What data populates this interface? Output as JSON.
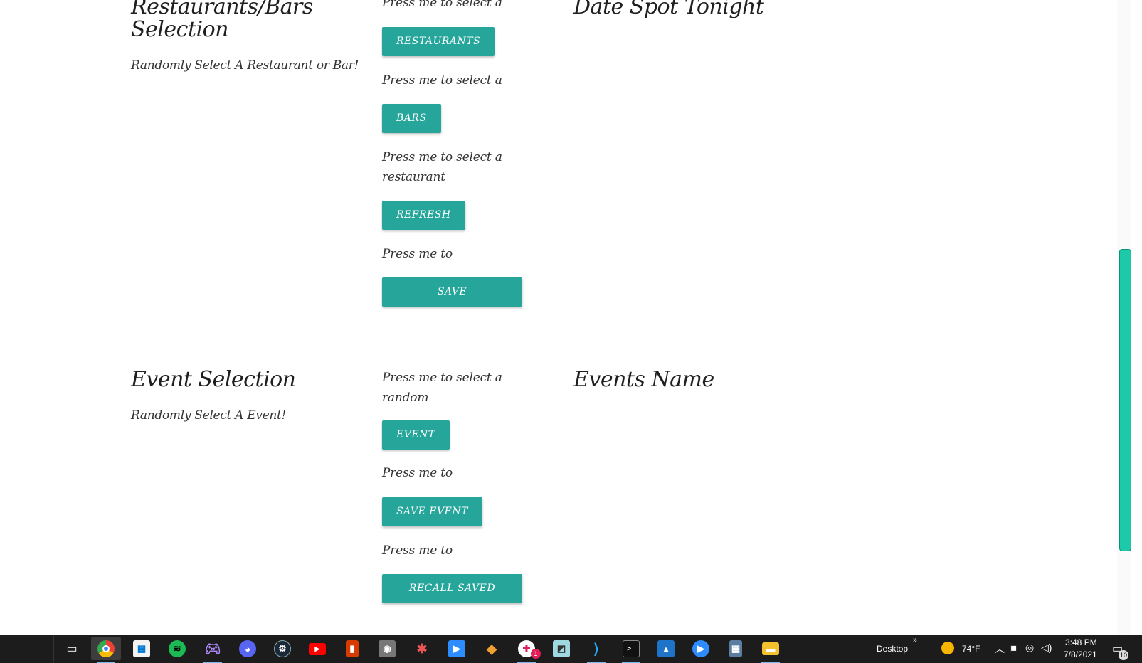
{
  "restaurants_section": {
    "title": "Restaurants/Bars Selection",
    "subtitle": "Randomly Select A Restaurant or Bar!",
    "result_title": "Date Spot Tonight",
    "actions": [
      {
        "prompt": "Press me to select a",
        "button": "RESTAURANTS"
      },
      {
        "prompt": "Press me to select a",
        "button": "BARS"
      },
      {
        "prompt": "Press me to select a restaurant",
        "button": "REFRESH"
      },
      {
        "prompt": "Press me to",
        "button": "SAVE"
      }
    ]
  },
  "events_section": {
    "title": "Event Selection",
    "subtitle": "Randomly Select A Event!",
    "result_title": "Events Name",
    "actions": [
      {
        "prompt": "Press me to select a random",
        "button": "EVENT"
      },
      {
        "prompt": "Press me to",
        "button": "SAVE EVENT"
      },
      {
        "prompt": "Press me to",
        "button": "RECALL SAVED"
      }
    ]
  },
  "colors": {
    "button": "#26a69a",
    "scroll_thumb": "#1ec9a9",
    "taskbar": "#1c1c1c"
  },
  "taskbar": {
    "apps": [
      "task-view-icon",
      "chrome-icon",
      "store-icon",
      "spotify-icon",
      "game-controller-icon",
      "discord-icon",
      "steam-icon",
      "youtube-icon",
      "office-icon",
      "camera-icon",
      "app-icon",
      "zoom-icon",
      "git-icon",
      "slack-icon",
      "notepad-icon",
      "vscode-icon",
      "terminal-icon",
      "photos-icon",
      "zoom-meetings-icon",
      "calculator-icon",
      "file-explorer-icon"
    ],
    "slack_badge": "1",
    "desktop_label": "Desktop",
    "temperature": "74°F",
    "time": "3:48 PM",
    "date": "7/8/2021",
    "notification_count": "10"
  }
}
